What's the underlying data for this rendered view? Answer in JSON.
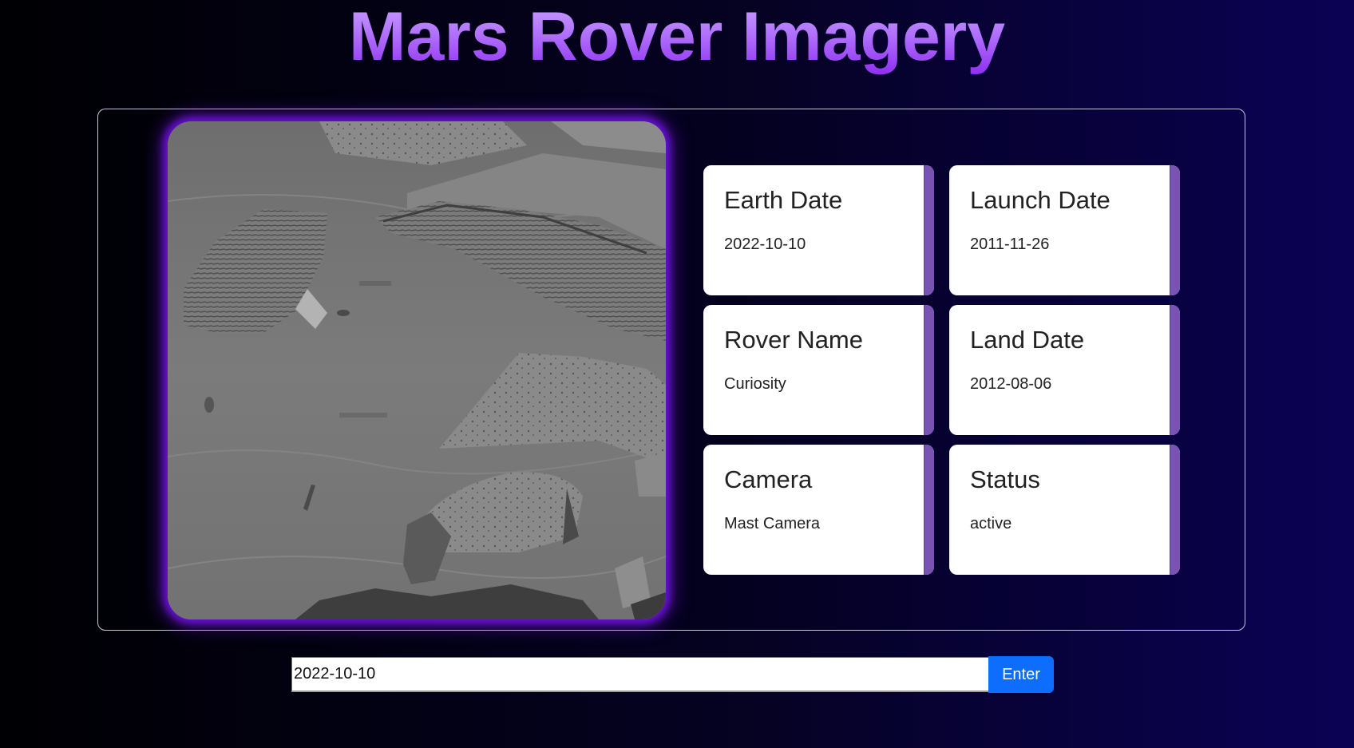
{
  "header": {
    "title": "Mars Rover Imagery"
  },
  "photo": {
    "description_icon": "mars-surface-photo"
  },
  "cards": [
    {
      "title": "Earth Date",
      "value": "2022-10-10"
    },
    {
      "title": "Launch Date",
      "value": "2011-11-26"
    },
    {
      "title": "Rover Name",
      "value": "Curiosity"
    },
    {
      "title": "Land Date",
      "value": "2012-08-06"
    },
    {
      "title": "Camera",
      "value": "Mast Camera"
    },
    {
      "title": "Status",
      "value": "active"
    }
  ],
  "search": {
    "value": "2022-10-10",
    "button_label": "Enter"
  },
  "colors": {
    "title_gradient_top": "#c9a3ff",
    "title_gradient_bottom": "#8e2cf0",
    "card_accent": "#7a52b3",
    "button": "#0d6efd",
    "photo_glow": "#6a10d8"
  }
}
